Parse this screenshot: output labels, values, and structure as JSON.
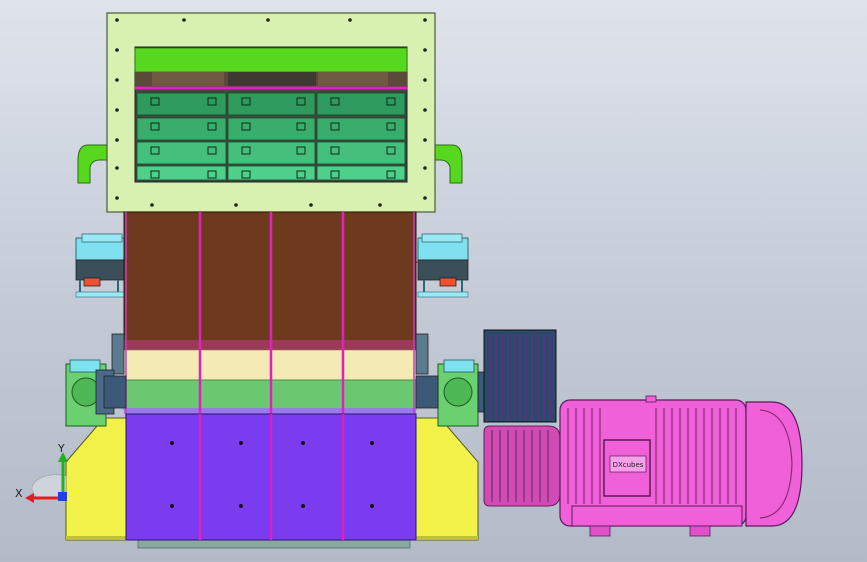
{
  "viewport": {
    "background": "#c9cfd9"
  },
  "colors": {
    "feed_frame": "#d8f0b0",
    "feed_green_bar": "#55d81e",
    "magenta_line": "#e020c0",
    "screen_tiles": [
      "#2e9a5e",
      "#38ad6c",
      "#44c07c",
      "#4fd08a"
    ],
    "brown_chamber": "#6e3a1e",
    "cream_band": "#f4eab4",
    "green_band": "#6cc870",
    "rotor_purple": "#7b3cf0",
    "base_yellow": "#f2f24a",
    "bearing_cyan": "#7fe0f0",
    "bearing_green": "#70d070",
    "motor_pink": "#f060d8",
    "pulley_pink": "#d04cb4",
    "axis_x": "#e02020",
    "axis_y": "#20b020",
    "axis_z": "#2040e0"
  },
  "motor": {
    "nameplate_text": "DXcubes"
  },
  "axis_triad": {
    "x_label": "X",
    "y_label": "Y"
  }
}
